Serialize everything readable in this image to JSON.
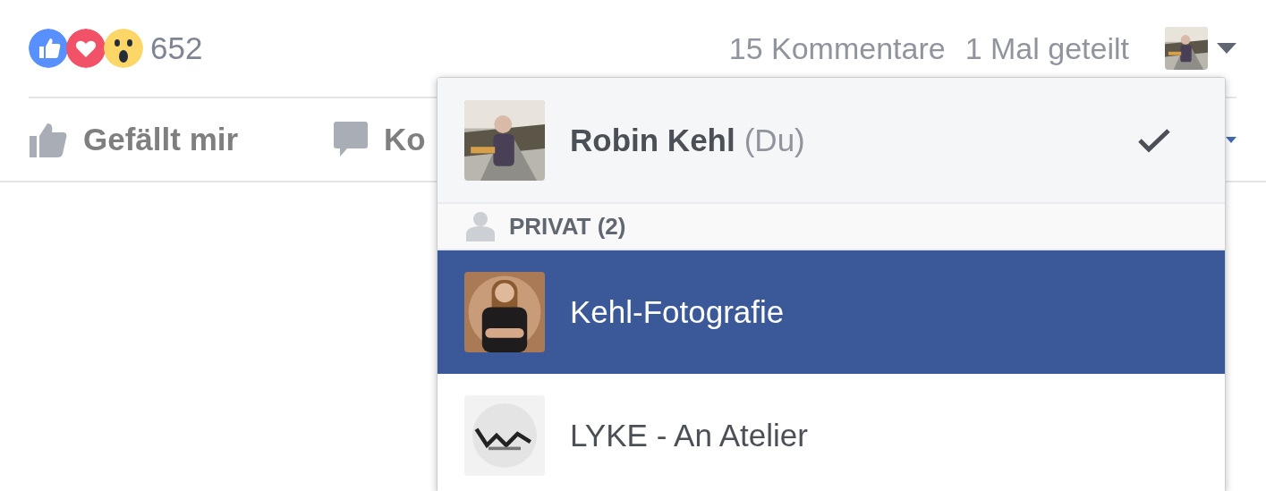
{
  "reactions": {
    "items": [
      {
        "kind": "like"
      },
      {
        "kind": "love"
      },
      {
        "kind": "wow"
      }
    ],
    "count": "652"
  },
  "stats": {
    "comments": "15 Kommentare",
    "shares": "1 Mal geteilt"
  },
  "actions": [
    {
      "kind": "like",
      "label": "Gefällt mir"
    },
    {
      "kind": "comment",
      "label": "Ko"
    }
  ],
  "identity_menu": {
    "profile": {
      "name": "Robin Kehl",
      "suffix": "(Du)",
      "checked": true
    },
    "section": {
      "label": "PRIVAT (2)"
    },
    "pages": [
      {
        "name": "Kehl-Fotografie",
        "selected": true,
        "checked": false
      },
      {
        "name": "LYKE - An Atelier",
        "selected": false,
        "checked": false
      }
    ]
  }
}
